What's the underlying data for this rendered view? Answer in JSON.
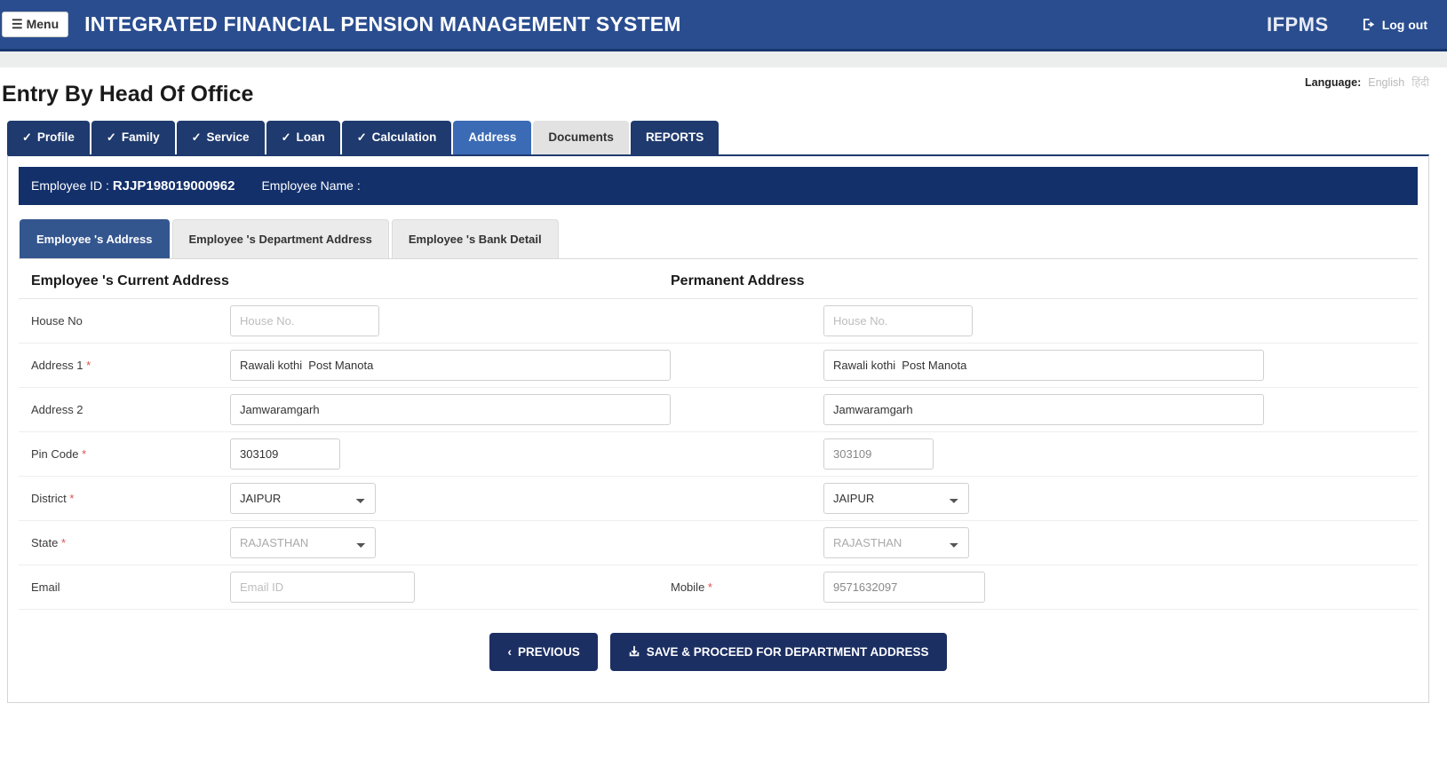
{
  "header": {
    "menu_label": "Menu",
    "menu_icon": "hamburger-icon",
    "app_title": "INTEGRATED FINANCIAL PENSION MANAGEMENT SYSTEM",
    "brand_abbr": "IFPMS",
    "logout_label": "Log out",
    "logout_icon": "logout-icon"
  },
  "page": {
    "title": "Entry By Head Of Office",
    "language_label": "Language:",
    "language_options": [
      "English",
      "हिंदी"
    ]
  },
  "tabs": [
    {
      "label": "Profile",
      "icon": "check-circle-icon",
      "state": "done"
    },
    {
      "label": "Family",
      "icon": "check-circle-icon",
      "state": "done"
    },
    {
      "label": "Service",
      "icon": "check-circle-icon",
      "state": "done"
    },
    {
      "label": "Loan",
      "icon": "check-circle-icon",
      "state": "done"
    },
    {
      "label": "Calculation",
      "icon": "check-circle-icon",
      "state": "done"
    },
    {
      "label": "Address",
      "icon": "",
      "state": "active"
    },
    {
      "label": "Documents",
      "icon": "",
      "state": "gray"
    },
    {
      "label": "REPORTS",
      "icon": "",
      "state": "plain"
    }
  ],
  "employee": {
    "id_label": "Employee ID :",
    "id_value": "RJJP198019000962",
    "name_label": "Employee Name :",
    "name_value": ""
  },
  "subtabs": [
    {
      "label": "Employee 's Address",
      "active": true
    },
    {
      "label": "Employee 's Department Address",
      "active": false
    },
    {
      "label": "Employee 's Bank Detail",
      "active": false
    }
  ],
  "form": {
    "current_heading": "Employee 's Current Address",
    "permanent_heading": "Permanent Address",
    "labels": {
      "house_no": "House No",
      "address1": "Address 1",
      "address2": "Address 2",
      "pin_code": "Pin Code",
      "district": "District",
      "state": "State",
      "email": "Email",
      "mobile": "Mobile"
    },
    "required_mark": "*",
    "placeholders": {
      "house_no": "House No.",
      "email": "Email ID"
    },
    "current": {
      "house_no": "",
      "address1": "Rawali kothi  Post Manota",
      "address2": "Jamwaramgarh",
      "pin_code": "303109",
      "district": "JAIPUR",
      "state": "RAJASTHAN",
      "email": ""
    },
    "permanent": {
      "house_no": "",
      "address1": "Rawali kothi  Post Manota",
      "address2": "Jamwaramgarh",
      "pin_code": "303109",
      "district": "JAIPUR",
      "state": "RAJASTHAN",
      "mobile": "9571632097"
    }
  },
  "actions": {
    "previous_label": "PREVIOUS",
    "previous_icon": "chevron-left-icon",
    "save_label": "SAVE & PROCEED FOR DEPARTMENT ADDRESS",
    "save_icon": "save-icon"
  },
  "colors": {
    "header_blue": "#2a4d8f",
    "dark_blue": "#1f3a6e",
    "active_tab_blue": "#3b6bb5",
    "emp_bar_blue": "#13306b",
    "required_red": "#d9534f"
  }
}
